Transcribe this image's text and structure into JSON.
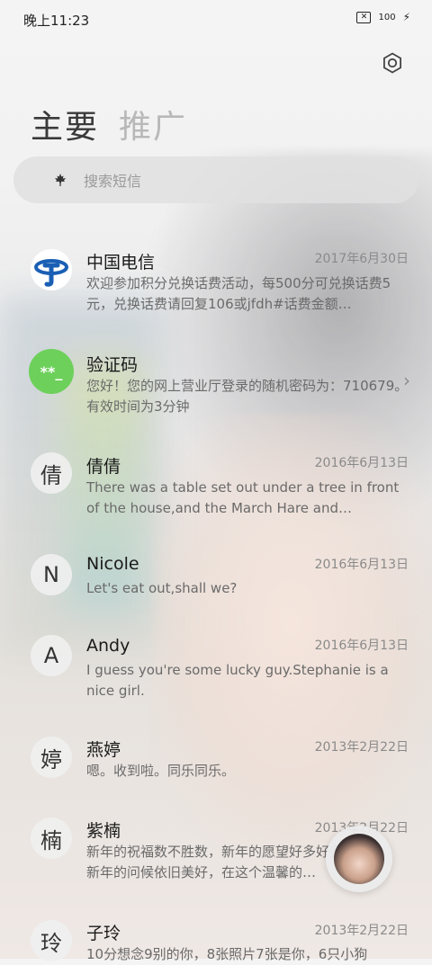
{
  "status_bar": {
    "time": "晚上11:23",
    "battery": "100",
    "sim_icon": "sim-off-icon",
    "charge_icon": "charging-icon"
  },
  "header": {
    "settings_icon": "gear-icon"
  },
  "tabs": [
    {
      "label": "主要",
      "active": true
    },
    {
      "label": "推广",
      "active": false
    }
  ],
  "search": {
    "placeholder": "搜索短信",
    "icon": "maple-leaf-icon"
  },
  "messages": [
    {
      "avatar": "telecom-logo",
      "avatar_text": "",
      "name": "中国电信",
      "date": "2017年6月30日",
      "preview": "欢迎参加积分兑换话费活动，每500分可兑换话费5元，兑换话费请回复106或jfdh#话费金额…"
    },
    {
      "avatar": "code-badge",
      "avatar_text": "**_",
      "name": "验证码",
      "date": "",
      "preview": "您好！您的网上营业厅登录的随机密码为：710679。有效时间为3分钟",
      "chevron": "›"
    },
    {
      "avatar_text": "倩",
      "name": "倩倩",
      "date": "2016年6月13日",
      "preview": "There was a table set out under a tree in front of the house,and the March Hare and…"
    },
    {
      "avatar_text": "N",
      "name": "Nicole",
      "date": "2016年6月13日",
      "preview": "Let's eat out,shall we?"
    },
    {
      "avatar_text": "A",
      "name": "Andy",
      "date": "2016年6月13日",
      "preview": "I guess you're some lucky guy.Stephanie is a nice girl."
    },
    {
      "avatar_text": "婷",
      "name": "燕婷",
      "date": "2013年2月22日",
      "preview": "嗯。收到啦。同乐同乐。"
    },
    {
      "avatar_text": "楠",
      "name": "紫楠",
      "date": "2013年2月22日",
      "preview": "新年的祝福数不胜数，新年的愿望好多好多，新年的问候依旧美好，在这个温馨的…"
    },
    {
      "avatar_text": "玲",
      "name": "子玲",
      "date": "2013年2月22日",
      "preview": "10分想念9别的你，8张照片7张是你，6只小狗"
    }
  ],
  "fab": {
    "icon": "compose-avatar-icon"
  }
}
